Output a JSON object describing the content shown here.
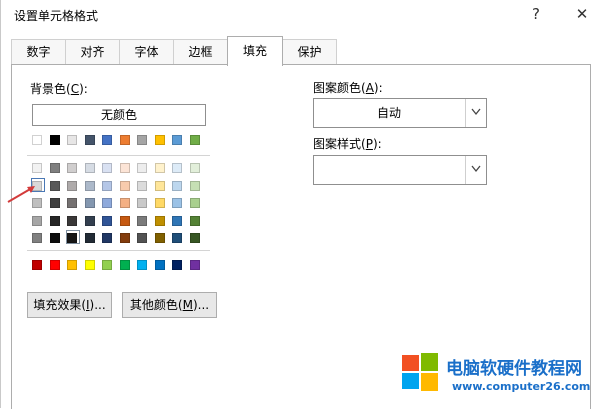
{
  "dialog": {
    "title": "设置单元格格式",
    "help": "?",
    "close": "✕"
  },
  "tabs": [
    {
      "label": "数字",
      "active": false
    },
    {
      "label": "对齐",
      "active": false
    },
    {
      "label": "字体",
      "active": false
    },
    {
      "label": "边框",
      "active": false
    },
    {
      "label": "填充",
      "active": true
    },
    {
      "label": "保护",
      "active": false
    }
  ],
  "background": {
    "label_text": "背景色(",
    "label_key": "C",
    "label_end": "):",
    "no_color": "无颜色",
    "row_theme_top": [
      "#FFFFFF",
      "#000000",
      "#E7E6E6",
      "#44546A",
      "#4472C4",
      "#ED7D31",
      "#A5A5A5",
      "#FFC000",
      "#5B9BD5",
      "#70AD47"
    ],
    "tint_rows": [
      [
        "#F2F2F2",
        "#7F7F7F",
        "#D0CECE",
        "#D6DCE4",
        "#D9E1F2",
        "#FCE4D6",
        "#EDEDED",
        "#FFF2CC",
        "#DDEBF7",
        "#E2EFDA"
      ],
      [
        "#D9D9D9",
        "#595959",
        "#AEAAAA",
        "#ACB9CA",
        "#B4C6E7",
        "#F8CBAD",
        "#DBDBDB",
        "#FFE699",
        "#BDD7EE",
        "#C6E0B4"
      ],
      [
        "#BFBFBF",
        "#404040",
        "#757171",
        "#8497B0",
        "#8EA9DB",
        "#F4B084",
        "#C9C9C9",
        "#FFD966",
        "#9BC2E6",
        "#A9D08E"
      ],
      [
        "#A6A6A6",
        "#262626",
        "#3A3838",
        "#333F4F",
        "#305496",
        "#C65911",
        "#7B7B7B",
        "#BF8F00",
        "#2F75B5",
        "#548235"
      ],
      [
        "#808080",
        "#0D0D0D",
        "#161616",
        "#222B35",
        "#203764",
        "#833C0C",
        "#525252",
        "#806000",
        "#1F4E78",
        "#375623"
      ]
    ],
    "standard_row": [
      "#C00000",
      "#FF0000",
      "#FFC000",
      "#FFFF00",
      "#92D050",
      "#00B050",
      "#00B0F0",
      "#0070C0",
      "#002060",
      "#7030A0"
    ],
    "fill_effects_label": "填充效果(",
    "fill_effects_key": "I",
    "fill_effects_end": ")...",
    "more_colors_label": "其他颜色(",
    "more_colors_key": "M",
    "more_colors_end": ")..."
  },
  "pattern": {
    "color_label": "图案颜色(",
    "color_key": "A",
    "color_end": "):",
    "color_value": "自动",
    "style_label": "图案样式(",
    "style_key": "P",
    "style_end": "):",
    "style_value": ""
  },
  "watermark": {
    "text": "电脑软硬件教程网",
    "url": "www.computer26.com",
    "colors": [
      "#F25022",
      "#7FBA00",
      "#00A4EF",
      "#FFB900"
    ]
  }
}
